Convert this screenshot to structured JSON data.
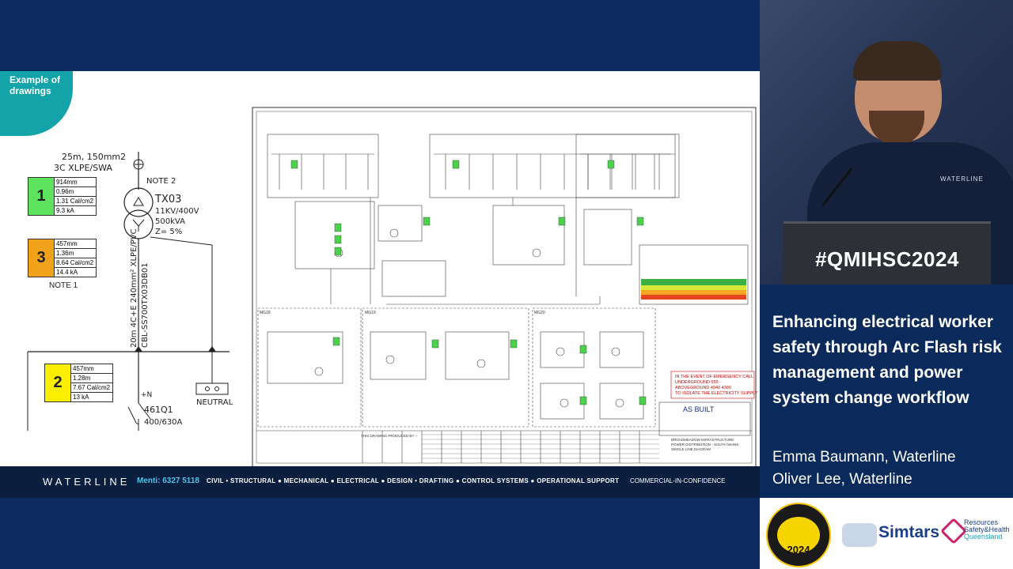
{
  "slide": {
    "badge": "Example of drawings",
    "cable_top": "25m, 150mm2",
    "cable_top2": "3C XLPE/SWA",
    "note2": "NOTE 2",
    "note1": "NOTE 1",
    "transformer": {
      "name": "TX03",
      "line1": "11KV/400V",
      "line2": "500kVA",
      "line3": "Z= 5%"
    },
    "cable_vertical": "20m 4C+E 240mm² XLPE/PVC",
    "cable_vertical2": "CBL-SS700TX03DB01",
    "breaker": "461Q1",
    "breaker_rating": "400/630A",
    "neutral": "NEUTRAL",
    "plus_n": "+N",
    "labels": [
      {
        "num": "1",
        "color": "#5ee35e",
        "rows": [
          "914mm",
          "0.96m",
          "1.31 Cal/cm2",
          "9.3 kA"
        ]
      },
      {
        "num": "3",
        "color": "#f2a21a",
        "rows": [
          "457mm",
          "1.36m",
          "8.64 Cal/cm2",
          "14.4 kA"
        ]
      },
      {
        "num": "2",
        "color": "#f8f000",
        "rows": [
          "457mm",
          "1.28m",
          "7.67 Cal/cm2",
          "13 kA"
        ]
      }
    ],
    "drawing": {
      "as_built": "AS BUILT",
      "emergency": [
        "IN THE EVENT OF EMERGENCY CALL",
        "UNDERGROUND 555",
        "ABOVEGROUND 4940 4300",
        "TO ISOLATE THE ELECTRICITY SUPPLY"
      ],
      "produced_by": "THIS DRAWING PRODUCED BY :-",
      "title_block": [
        "BROADMEADOW INFRASTRUCTURE",
        "POWER DISTRIBUTION - SOUTH MAINS",
        "SINGLE LINE DIAGRAM"
      ],
      "mg_labels": [
        "MG18",
        "MG19",
        "MG20"
      ]
    }
  },
  "footer": {
    "brand": "WATERLINE",
    "menti": "Menti: 6327 5118",
    "services": "CIVIL • STRUCTURAL ● MECHANICAL ● ELECTRICAL ● DESIGN • DRAFTING ● CONTROL SYSTEMS ● OPERATIONAL SUPPORT",
    "confidential": "COMMERCIAL-IN-CONFIDENCE"
  },
  "video": {
    "podium_hashtag": "#QMIHSC2024",
    "shirt_logo": "WATERLINE"
  },
  "info": {
    "title": "Enhancing electrical worker safety through Arc Flash risk management and power system change workflow",
    "speaker1": "Emma Baumann, Waterline",
    "speaker2": "Oliver Lee, Waterline"
  },
  "logos": {
    "qmihsc_year": "2024",
    "simtars": "Simtars",
    "rshq_line1": "Resources",
    "rshq_line2": "Safety&Health",
    "rshq_line3": "Queensland"
  }
}
